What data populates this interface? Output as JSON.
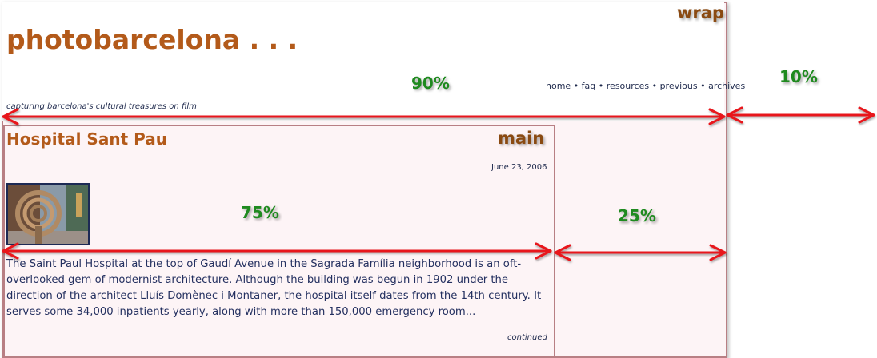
{
  "annotations": {
    "wrap": "wrap",
    "main": "main",
    "wrap_width": "90%",
    "outside_width": "10%",
    "main_width": "75%",
    "sidebar_width": "25%"
  },
  "site": {
    "title": "photobarcelona . . .",
    "tagline": "capturing barcelona's cultural treasures on film"
  },
  "nav": {
    "items": [
      "home",
      "faq",
      "resources",
      "previous",
      "archives"
    ],
    "separator": " • "
  },
  "post": {
    "title": "Hospital Sant Pau",
    "date": "June 23, 2006",
    "excerpt": "The Saint Paul Hospital at the top of Gaudí Avenue in the Sagrada Família neighborhood is an oft-overlooked gem of modernist architecture. Although the building was begun in 1902 under the direction of the architect Lluís Domènec i Montaner, the hospital itself dates from the 14th century. It serves some 34,000 inpatients yearly, along with more than 150,000 emergency room...",
    "more_link": "continued"
  },
  "colors": {
    "title": "#b35a1a",
    "annotation_label": "#8a4a12",
    "percentage_label": "#1f8a1f",
    "arrow": "#e8141a",
    "box_border": "#b87f84",
    "box_fill": "#fdf4f6",
    "text": "#1f2a4d"
  }
}
